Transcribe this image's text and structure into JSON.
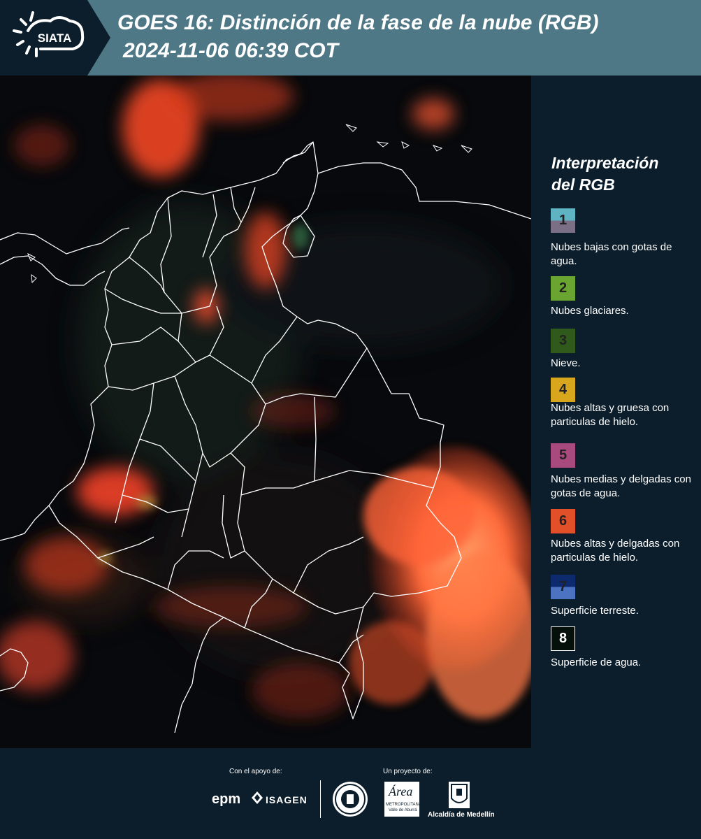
{
  "header": {
    "logo_text": "SIATA",
    "title_line1": "GOES 16: Distinción de la fase de la nube (RGB)",
    "title_line2": "2024-11-06 06:39 COT"
  },
  "legend": {
    "title_line1": "Interpretación",
    "title_line2": "del RGB",
    "items": [
      {
        "number": "1",
        "label": "Nubes bajas con gotas de agua.",
        "color_top": "#5fb4c4",
        "color_bottom": "#7b6f86"
      },
      {
        "number": "2",
        "label": "Nubes glaciares.",
        "color_top": "#6aa532",
        "color_bottom": "#6aa532"
      },
      {
        "number": "3",
        "label": "Nieve.",
        "color_top": "#2f5a1b",
        "color_bottom": "#2f5a1b"
      },
      {
        "number": "4",
        "label": "Nubes altas y gruesa con particulas de hielo.",
        "color_top": "#d8a61c",
        "color_bottom": "#d8a61c"
      },
      {
        "number": "5",
        "label": "Nubes medias y delgadas con gotas de agua.",
        "color_top": "#a94a7e",
        "color_bottom": "#a94a7e"
      },
      {
        "number": "6",
        "label": "Nubes altas y delgadas con particulas de hielo.",
        "color_top": "#e2502a",
        "color_bottom": "#e2502a"
      },
      {
        "number": "7",
        "label": "Superficie terreste.",
        "color_top": "#0d2a6e",
        "color_bottom": "#4b73c2"
      },
      {
        "number": "8",
        "label": "Superficie de agua.",
        "color_top": "#05100b",
        "color_bottom": "#05100b"
      }
    ]
  },
  "footer": {
    "support_label": "Con el apoyo de:",
    "project_label": "Un proyecto de:",
    "epm_text": "epm",
    "isagen_text": "ISAGEN",
    "area_text": "Área",
    "area_sub1": "METROPOLITANA",
    "area_sub2": "Valle de Aburrá",
    "alcaldia_text": "Alcaldía de Medellín"
  },
  "colors": {
    "header_bg": "#4f7887",
    "panel_bg": "#0c1e2b",
    "cloud_ice": "#ff4a26"
  }
}
